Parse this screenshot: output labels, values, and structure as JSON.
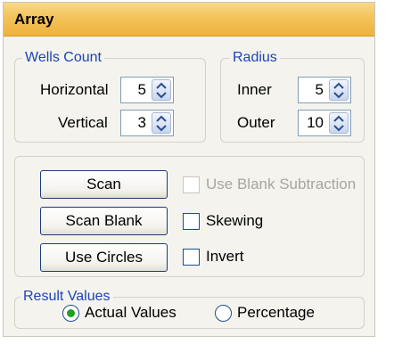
{
  "panel": {
    "title": "Array"
  },
  "wells_count": {
    "legend": "Wells Count",
    "horizontal": {
      "label": "Horizontal",
      "value": "5"
    },
    "vertical": {
      "label": "Vertical",
      "value": "3"
    }
  },
  "radius": {
    "legend": "Radius",
    "inner": {
      "label": "Inner",
      "value": "5"
    },
    "outer": {
      "label": "Outer",
      "value": "10"
    }
  },
  "actions": {
    "scan": "Scan",
    "scan_blank": "Scan Blank",
    "use_circles": "Use Circles"
  },
  "options": {
    "use_blank_subtraction": {
      "label": "Use Blank Subtraction",
      "checked": false,
      "enabled": false
    },
    "skewing": {
      "label": "Skewing",
      "checked": false,
      "enabled": true
    },
    "invert": {
      "label": "Invert",
      "checked": false,
      "enabled": true
    }
  },
  "result_values": {
    "legend": "Result Values",
    "actual_values": {
      "label": "Actual Values",
      "selected": true
    },
    "percentage": {
      "label": "Percentage",
      "selected": false
    }
  },
  "colors": {
    "title_bar": "#f3c35a",
    "group_legend": "#1a45b8",
    "radio_selected": "#21a121"
  }
}
